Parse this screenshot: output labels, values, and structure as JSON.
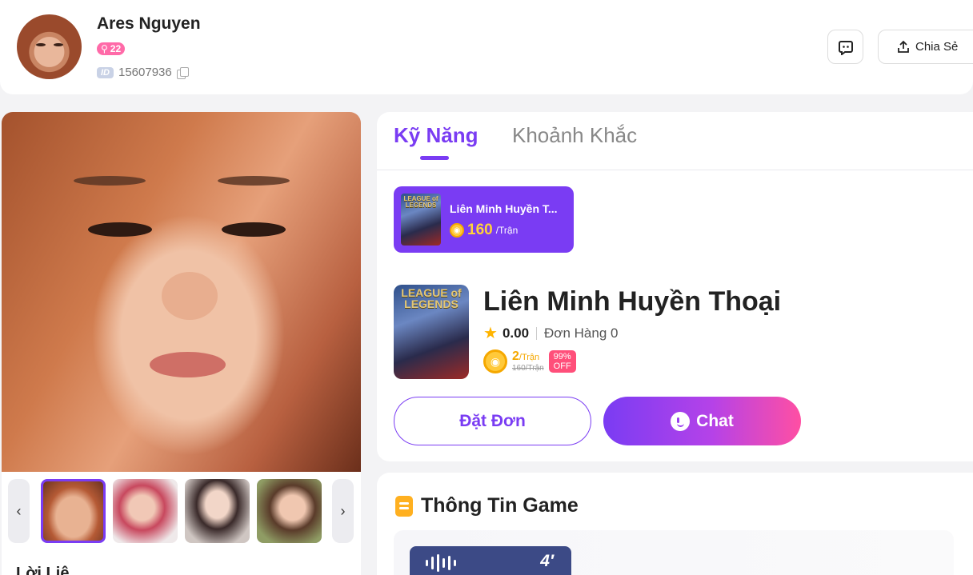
{
  "profile": {
    "name": "Ares Nguyen",
    "level": "22",
    "id_tag": "ID",
    "id": "15607936"
  },
  "header": {
    "share_label": "Chia Sẻ"
  },
  "gallery": {
    "prev": "‹",
    "next": "›",
    "section_label": "Lời Liệ"
  },
  "tabs": {
    "skill": "Kỹ Năng",
    "moment": "Khoảnh Khắc"
  },
  "game_chip": {
    "art_label": "LEAGUE of LEGENDS",
    "title": "Liên Minh Huyền T...",
    "price": "160",
    "unit": "/Trận"
  },
  "game": {
    "art_label": "LEAGUE of LEGENDS",
    "name": "Liên Minh Huyền Thoại",
    "rating": "0.00",
    "orders": "Đơn Hàng 0",
    "price_now": "2",
    "price_unit": "/Trận",
    "price_old": "160/Trận",
    "discount_pct": "99%",
    "discount_off": "OFF"
  },
  "actions": {
    "order": "Đặt Đơn",
    "chat": "Chat"
  },
  "info": {
    "title": "Thông Tin Game",
    "voice_duration": "4′"
  },
  "colors": {
    "accent": "#7a3cf3",
    "pink": "#ff4fa3",
    "gold": "#f5a800"
  }
}
